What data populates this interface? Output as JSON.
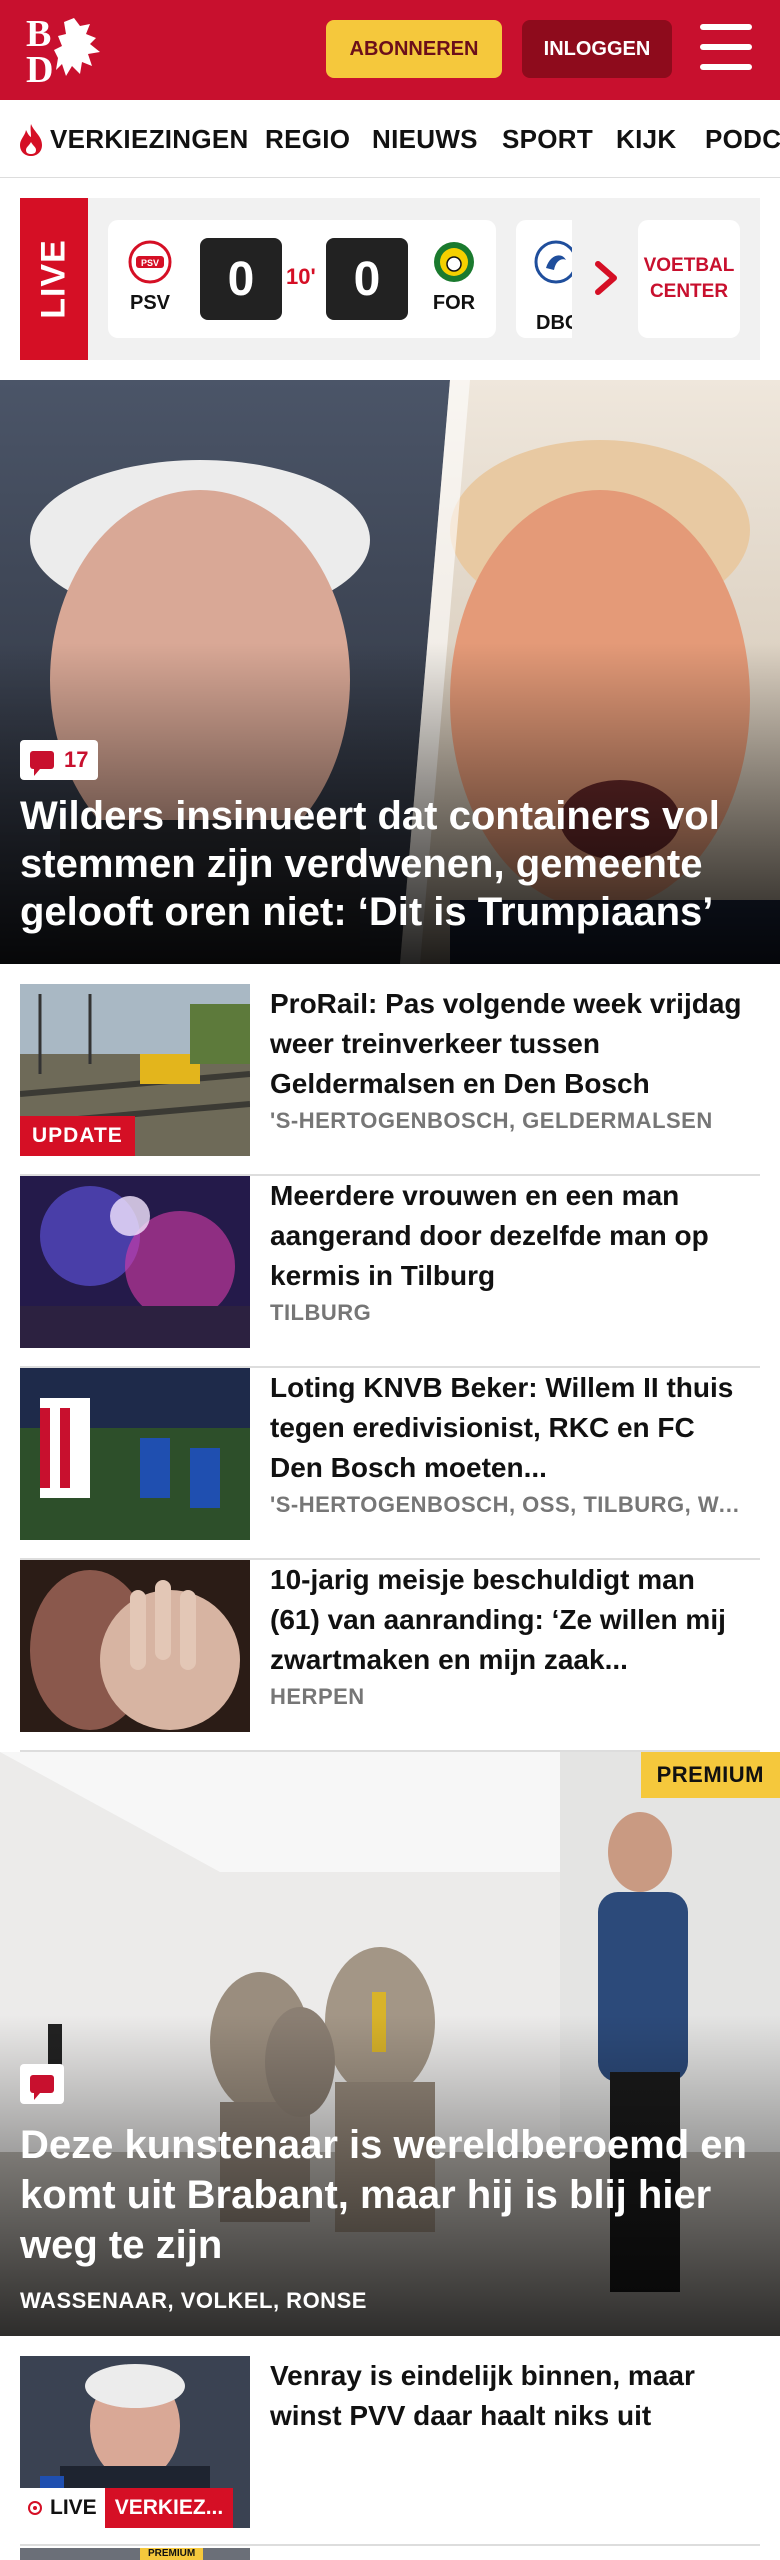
{
  "header": {
    "logo_text": "BD",
    "subscribe_label": "ABONNEREN",
    "login_label": "INLOGGEN"
  },
  "nav": {
    "items": [
      "VERKIEZINGEN",
      "REGIO",
      "NIEUWS",
      "SPORT",
      "KIJK",
      "PODCAST"
    ],
    "highlighted_icon": "flame-icon"
  },
  "live": {
    "label": "LIVE",
    "match": {
      "home": "PSV",
      "away": "FOR",
      "home_score": "0",
      "away_score": "0",
      "minute": "10'"
    },
    "next_club": "DBC",
    "voetbal_center": "VOETBAL CENTER"
  },
  "hero": {
    "comment_count": "17",
    "title": "Wilders insinueert dat containers vol stemmen zijn verdwenen, gemeente gelooft oren niet: ‘Dit is Trumpiaans’"
  },
  "articles": [
    {
      "tag": "UPDATE",
      "headline": "ProRail: Pas volgende week vrijdag weer treinverkeer tussen Geldermalsen en Den Bosch",
      "location": "'S-HERTOGENBOSCH, GELDERMALSEN"
    },
    {
      "headline": "Meerdere vrouwen en een man aangerand door dezelfde man op kermis in Tilburg",
      "location": "TILBURG"
    },
    {
      "headline": "Loting KNVB Beker: Willem II thuis tegen eredivisionist, RKC en FC Den Bosch moeten...",
      "location": "'S-HERTOGENBOSCH, OSS, TILBURG, WAALWIJK"
    },
    {
      "headline": "10-jarig meisje beschuldigt man (61) van aanranding: ‘Ze willen mij zwartmaken en mijn zaak...",
      "location": "HERPEN"
    }
  ],
  "premium_story": {
    "tag": "PREMIUM",
    "title": "Deze kunstenaar is wereldberoemd en komt uit Brabant, maar hij is blij hier weg te zijn",
    "location": "WASSENAAR, VOLKEL, RONSE"
  },
  "bottom_article": {
    "headline": "Venray is eindelijk binnen, maar winst PVV daar haalt niks uit",
    "live_label": "LIVE",
    "category_label": "VERKIEZ...",
    "next_tag": "PREMIUM"
  },
  "colors": {
    "brand_red": "#c8102e",
    "premium_yellow": "#f5c83c",
    "dark_red": "#8e0b1c"
  }
}
